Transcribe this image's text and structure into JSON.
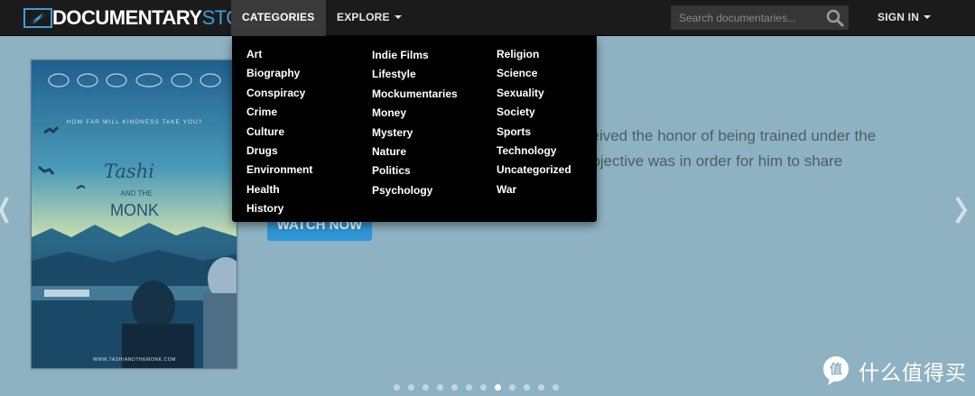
{
  "brand": {
    "name_part1": "DOCUMENTARY",
    "name_part2": "STORM"
  },
  "nav": {
    "categories_label": "CATEGORIES",
    "explore_label": "EXPLORE",
    "sign_in_label": "SIGN IN"
  },
  "search": {
    "placeholder": "Search documentaries..."
  },
  "categories": {
    "column1": [
      "Art",
      "Biography",
      "Conspiracy",
      "Crime",
      "Culture",
      "Drugs",
      "Environment",
      "Health",
      "History"
    ],
    "column2": [
      "Indie Films",
      "Lifestyle",
      "Mockumentaries",
      "Money",
      "Mystery",
      "Nature",
      "Politics",
      "Psychology"
    ],
    "column3": [
      "Religion",
      "Science",
      "Sexuality",
      "Society",
      "Sports",
      "Technology",
      "Uncategorized",
      "War"
    ]
  },
  "hero": {
    "description": "ceived the honor of being trained under the objective was in order for him to share",
    "watch_label": "WATCH NOW",
    "poster": {
      "tagline": "HOW FAR WILL KINDNESS TAKE YOU?",
      "title_line1": "Tashi",
      "title_line2": "AND THE",
      "title_line3": "MONK",
      "url": "WWW.TASHIANDTHEMONK.COM"
    },
    "slide_count": 12,
    "active_slide": 8
  },
  "watermark": {
    "text": "什么值得买",
    "logo_char": "值"
  },
  "colors": {
    "navbar": "#1b1b1b",
    "accent": "#3a9fd8",
    "hero_bg": "#8fb2c2",
    "button": "#2e97d7",
    "dropdown": "#000000"
  }
}
